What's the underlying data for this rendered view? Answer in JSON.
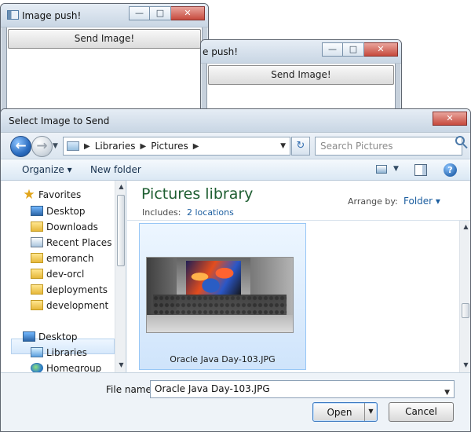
{
  "windows": [
    {
      "title": "Image push!",
      "button_label": "Send Image!"
    },
    {
      "title": "e push!",
      "button_label": "Send Image!"
    }
  ],
  "dialog": {
    "title": "Select Image to Send",
    "caption_buttons": {
      "minimize": "—",
      "maximize": "□",
      "close": "✕"
    },
    "breadcrumb": [
      "Libraries",
      "Pictures"
    ],
    "search_placeholder": "Search Pictures",
    "toolbar": {
      "organize": "Organize ▾",
      "new_folder": "New folder",
      "help": "?"
    },
    "navigation": {
      "items": [
        "Favorites",
        "Desktop",
        "Downloads",
        "Recent Places",
        "emoranch",
        "dev-orcl",
        "deployments",
        "development",
        "Desktop",
        "Libraries",
        "Homegroup"
      ],
      "selected": "Libraries"
    },
    "library": {
      "title": "Pictures library",
      "includes_label": "Includes:",
      "locations": "2 locations",
      "arrange_label": "Arrange by:",
      "arrange_value": "Folder ▾"
    },
    "file": {
      "name": "Oracle Java Day-103.JPG"
    },
    "bottom": {
      "filename_label": "File name:",
      "filename_value": "Oracle Java Day-103.JPG",
      "open_label": "Open",
      "cancel_label": "Cancel"
    }
  },
  "icons": {
    "search": "search-icon",
    "back": "back-arrow-icon",
    "forward": "forward-arrow-icon",
    "refresh": "refresh-icon",
    "help": "help-icon"
  },
  "colors": {
    "window_chrome": "#c9d6e4",
    "selection": "#cfe4fb",
    "library_title": "#1e5e31",
    "link": "#1d5fa0",
    "close_button": "#c64a3d"
  }
}
